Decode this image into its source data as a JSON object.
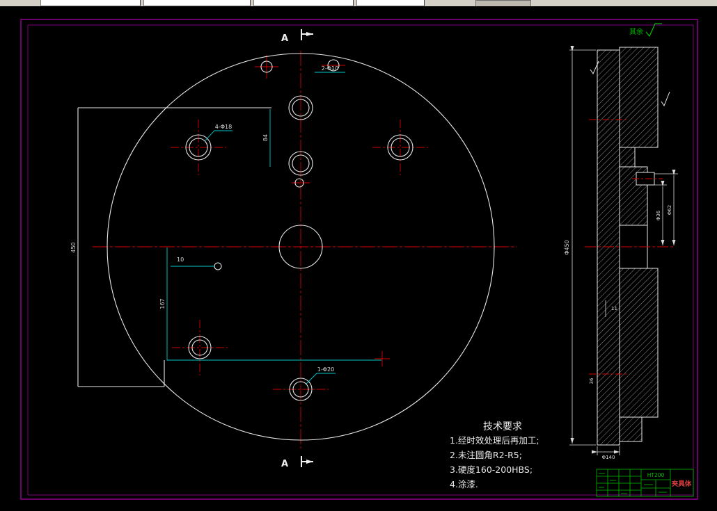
{
  "drawing": {
    "section_label": "A",
    "surface_note": "其余",
    "main_view": {
      "dims": {
        "top_holes": "2-Φ10",
        "corner_holes": "4-Φ18",
        "bottom_hole": "1-Φ20",
        "overall": "450",
        "step": "84",
        "slot_v": "167",
        "slot_h": "10"
      }
    },
    "section_view": {
      "dims": {
        "outer": "Φ450",
        "bore_inner": "Φ36",
        "bore_outer": "Φ62",
        "boss": "Φ140",
        "step": "11",
        "web": "36"
      }
    },
    "tech_requirements": {
      "title": "技术要求",
      "items": [
        "1.经时效处理后再加工;",
        "2.未注圆角R2-R5;",
        "3.硬度160-200HBS;",
        "4.涂漆."
      ]
    },
    "title_block": {
      "material": "HT200",
      "part_name": "夹具体"
    }
  },
  "colors": {
    "frame": "#b400b4",
    "centerline": "#d40000",
    "dimension": "#00c8c8",
    "annotation": "#00c000",
    "part_name_red": "#e04040"
  }
}
